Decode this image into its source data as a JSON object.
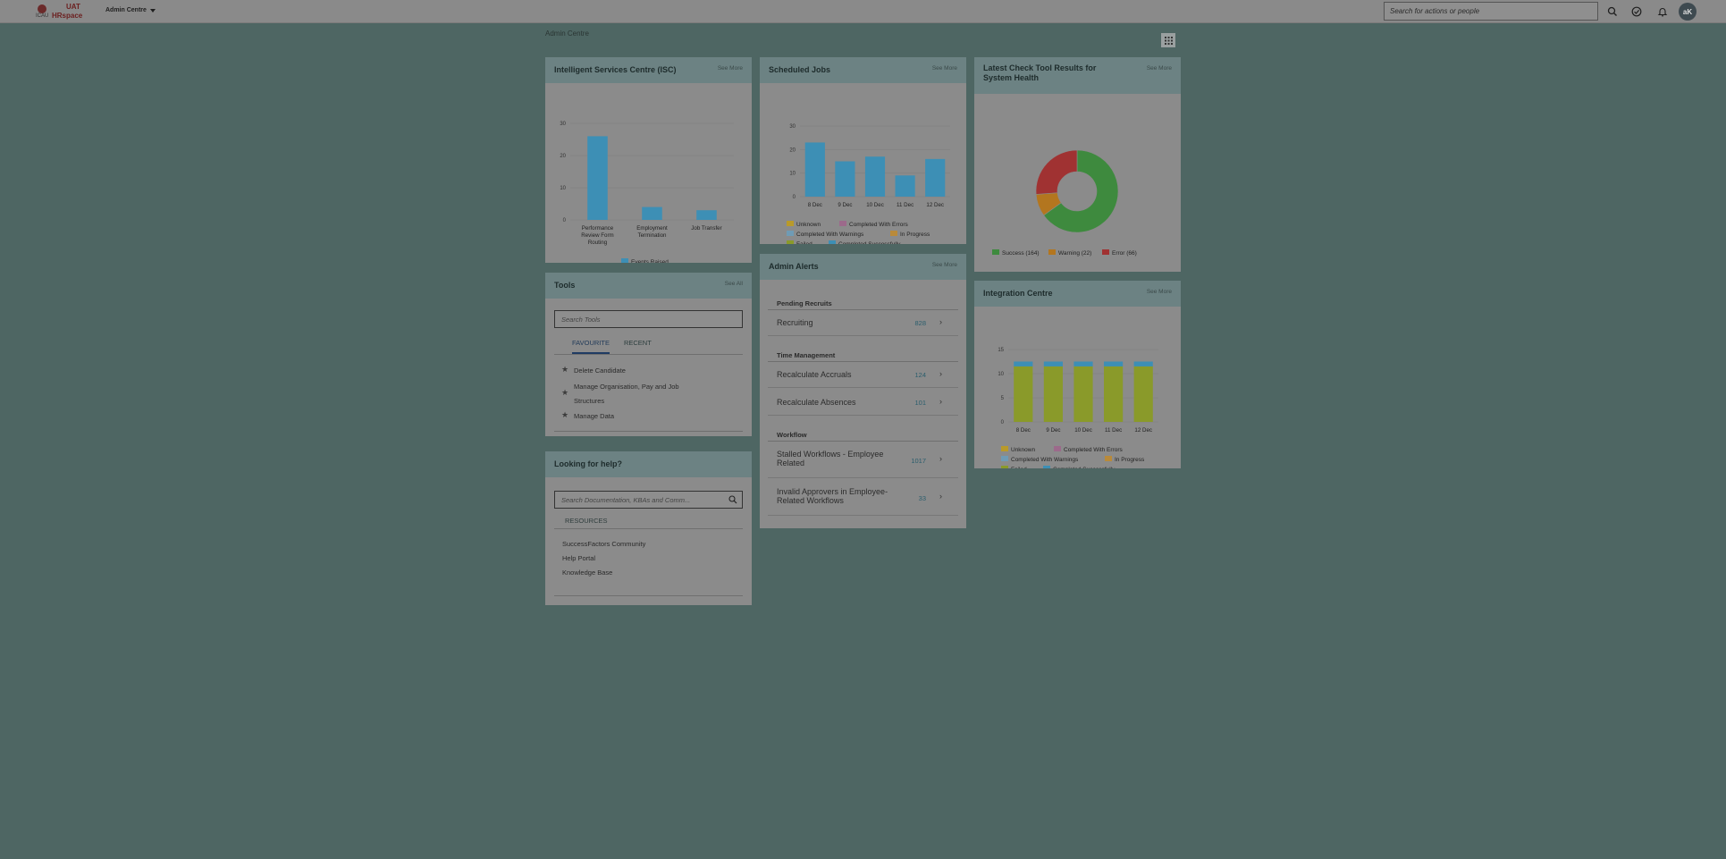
{
  "shell": {
    "logo_org": "ICAU",
    "logo_uat": "UAT",
    "logo_product": "HRspace",
    "app_menu": "Admin Centre",
    "search_placeholder": "Search for actions or people",
    "avatar_initials": "aK"
  },
  "page": {
    "title": "Admin Centre"
  },
  "isc": {
    "title": "Intelligent Services Centre (ISC)",
    "see_more": "See More",
    "legend": "Events Raised",
    "chart_data": {
      "type": "bar",
      "categories": [
        "Performance Review Form Routing",
        "Employment Termination",
        "Job Transfer"
      ],
      "category_lines": [
        [
          "Performance",
          "Review Form",
          "Routing"
        ],
        [
          "Employment",
          "Termination"
        ],
        [
          "Job Transfer"
        ]
      ],
      "series": [
        {
          "name": "Events Raised",
          "values": [
            26,
            4,
            3
          ]
        }
      ],
      "yticks": [
        "0",
        "10",
        "20",
        "30"
      ],
      "ylim": [
        0,
        30
      ],
      "color": "#3d8fb5"
    }
  },
  "jobs": {
    "title": "Scheduled Jobs",
    "see_more": "See More",
    "chart_data": {
      "type": "bar",
      "categories": [
        "8 Dec",
        "9 Dec",
        "10 Dec",
        "11 Dec",
        "12 Dec"
      ],
      "series": [
        {
          "name": "Completed Successfully",
          "values": [
            23,
            15,
            17,
            9,
            16
          ]
        }
      ],
      "yticks": [
        "0",
        "10",
        "20",
        "30"
      ],
      "ylim": [
        0,
        30
      ],
      "color": "#3d8fb5"
    },
    "legend": [
      {
        "label": "Unknown",
        "color": "#b99a2a"
      },
      {
        "label": "Completed With Errors",
        "color": "#9c6a8b"
      },
      {
        "label": "Completed With Warnings",
        "color": "#6f9bb5"
      },
      {
        "label": "In Progress",
        "color": "#b98a3a"
      },
      {
        "label": "Failed",
        "color": "#8a9a2a"
      },
      {
        "label": "Completed Successfully",
        "color": "#3d8fb5"
      }
    ]
  },
  "health": {
    "title_line1": "Latest Check Tool Results for",
    "title_line2": "System Health",
    "see_more": "See More",
    "chart_data": {
      "type": "pie",
      "slices": [
        {
          "name": "Success",
          "value": 164,
          "color": "#3e8a3e"
        },
        {
          "name": "Warning",
          "value": 22,
          "color": "#b3761f"
        },
        {
          "name": "Error",
          "value": 66,
          "color": "#a03232"
        }
      ]
    },
    "legend": [
      "Success (164)",
      "Warning (22)",
      "Error (66)"
    ]
  },
  "tools": {
    "title": "Tools",
    "see_all": "See All",
    "search_placeholder": "Search Tools",
    "tab_favourite": "FAVOURITE",
    "tab_recent": "RECENT",
    "items": [
      "Delete Candidate",
      "Manage Organisation, Pay and Job",
      "Structures",
      "Manage Data"
    ]
  },
  "alerts": {
    "title": "Admin Alerts",
    "see_more": "See More",
    "groups": {
      "pending": "Pending Recruits",
      "time": "Time Management",
      "workflow": "Workflow"
    },
    "rows": [
      {
        "label": "Recruiting",
        "count": "828"
      },
      {
        "label": "Recalculate Accruals",
        "count": "124"
      },
      {
        "label": "Recalculate Absences",
        "count": "101"
      },
      {
        "label": "Stalled Workflows - Employee",
        "label2": "Related",
        "count": "1017"
      },
      {
        "label": "Invalid Approvers in Employee-",
        "label2": "Related Workflows",
        "count": "33"
      }
    ]
  },
  "integration": {
    "title": "Integration Centre",
    "see_more": "See More",
    "chart_data": {
      "type": "bar",
      "categories": [
        "8 Dec",
        "9 Dec",
        "10 Dec",
        "11 Dec",
        "12 Dec"
      ],
      "series": [
        {
          "name": "Failed",
          "values": [
            11.5,
            11.5,
            11.5,
            11.5,
            11.5
          ],
          "color": "#8a9a2a"
        },
        {
          "name": "Completed Successfully",
          "values": [
            1,
            1,
            1,
            1,
            1
          ],
          "color": "#3d8fb5"
        }
      ],
      "yticks": [
        "0",
        "5",
        "10",
        "15"
      ],
      "ylim": [
        0,
        15
      ]
    },
    "legend": [
      {
        "label": "Unknown",
        "color": "#b99a2a"
      },
      {
        "label": "Completed With Errors",
        "color": "#9c6a8b"
      },
      {
        "label": "Completed With Warnings",
        "color": "#6f9bb5"
      },
      {
        "label": "In Progress",
        "color": "#b98a3a"
      },
      {
        "label": "Failed",
        "color": "#8a9a2a"
      },
      {
        "label": "Completed Successfully",
        "color": "#3d8fb5"
      }
    ]
  },
  "help": {
    "title": "Looking for help?",
    "search_placeholder": "Search Documentation, KBAs and Comm...",
    "resources_label": "RESOURCES",
    "links": [
      "SuccessFactors Community",
      "Help Portal",
      "Knowledge Base"
    ]
  }
}
